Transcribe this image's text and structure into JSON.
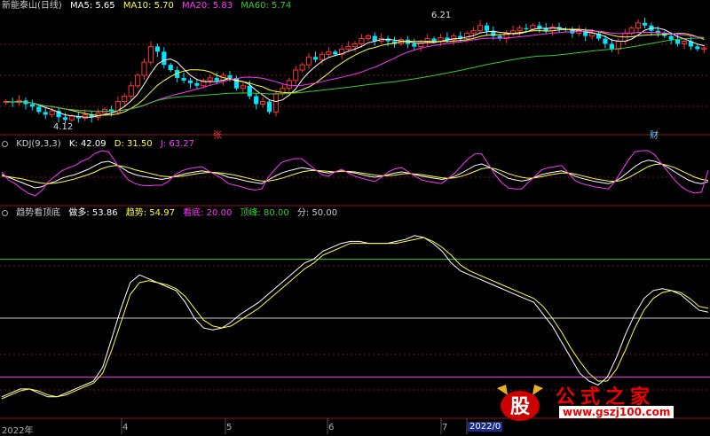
{
  "title": "新能泰山(日线)",
  "ma_labels": [
    {
      "text": "MA5: 5.65",
      "color": "#ffffff"
    },
    {
      "text": "MA10: 5.70",
      "color": "#ffff33"
    },
    {
      "text": "MA20: 5.83",
      "color": "#ff33ff"
    },
    {
      "text": "MA60: 5.74",
      "color": "#33cc33"
    }
  ],
  "kdj_labels": [
    {
      "text": "KDJ(9,3,3)",
      "color": "#cccccc"
    },
    {
      "text": "K: 42.09",
      "color": "#ffffff"
    },
    {
      "text": "D: 31.50",
      "color": "#ffff33"
    },
    {
      "text": "J: 63.27",
      "color": "#ff33ff"
    }
  ],
  "trend_labels": [
    {
      "text": "趋势看顶底",
      "color": "#cccccc"
    },
    {
      "text": "做多: 53.86",
      "color": "#ffffff"
    },
    {
      "text": "趋势: 54.97",
      "color": "#ffff33"
    },
    {
      "text": "看底: 20.00",
      "color": "#ff33ff"
    },
    {
      "text": "顶峰: 80.00",
      "color": "#33cc33"
    },
    {
      "text": "分: 50.00",
      "color": "#cccccc"
    }
  ],
  "annotations": {
    "high": "6.21",
    "low": "4.12",
    "marker_zhang": "张",
    "marker_cai": "财"
  },
  "x_axis": [
    {
      "label": "2022年"
    },
    {
      "label": "4"
    },
    {
      "label": "5"
    },
    {
      "label": "6"
    },
    {
      "label": "7"
    },
    {
      "label": "2022/0"
    }
  ],
  "watermark": {
    "logo_char": "股",
    "title": "公式之家",
    "url": "www.gszj100.com"
  },
  "colors": {
    "up": "#ff3030",
    "down": "#00e5ff",
    "ma5": "#ffffff",
    "ma10": "#ffff33",
    "ma20": "#ff33ff",
    "ma60": "#33cc33",
    "divider": "#8b1a1a",
    "grid": "#7a1a1a"
  },
  "chart_data": [
    {
      "type": "candlestick",
      "title": "新能泰山(日线)",
      "price_range": [
        4.0,
        6.3
      ],
      "close": [
        4.6,
        4.58,
        4.62,
        4.55,
        4.5,
        4.4,
        4.35,
        4.42,
        4.3,
        4.25,
        4.32,
        4.28,
        4.35,
        4.3,
        4.38,
        4.45,
        4.4,
        4.6,
        4.7,
        4.9,
        5.1,
        5.35,
        5.65,
        5.55,
        5.3,
        5.2,
        5.05,
        5.0,
        4.95,
        4.9,
        5.0,
        5.05,
        5.0,
        5.1,
        5.05,
        4.85,
        4.9,
        4.7,
        4.55,
        4.6,
        4.4,
        4.75,
        4.85,
        5.0,
        5.2,
        5.3,
        5.45,
        5.4,
        5.5,
        5.55,
        5.5,
        5.6,
        5.65,
        5.7,
        5.8,
        5.85,
        5.75,
        5.8,
        5.75,
        5.7,
        5.78,
        5.7,
        5.65,
        5.72,
        5.8,
        5.75,
        5.82,
        5.78,
        5.85,
        5.8,
        5.9,
        5.95,
        6.05,
        5.95,
        5.85,
        5.8,
        5.9,
        5.95,
        6.0,
        5.98,
        6.05,
        6.0,
        5.95,
        6.02,
        5.98,
        5.96,
        5.9,
        5.95,
        5.85,
        5.9,
        5.8,
        5.7,
        5.6,
        5.75,
        5.9,
        6.0,
        6.1,
        6.05,
        5.95,
        5.9,
        5.85,
        5.78,
        5.7,
        5.75,
        5.65,
        5.6,
        5.62
      ],
      "ma5_last": 5.65,
      "ma10_last": 5.7,
      "ma20_last": 5.83,
      "ma60_last": 5.74,
      "annotations": [
        {
          "text": "6.21"
        },
        {
          "text": "4.12"
        }
      ]
    },
    {
      "type": "line",
      "title": "KDJ(9,3,3)",
      "ylim": [
        0,
        100
      ],
      "series": [
        {
          "name": "K",
          "values": [
            55,
            50,
            45,
            40,
            35,
            30,
            32,
            38,
            42,
            48,
            52,
            55,
            60,
            65,
            72,
            78,
            80,
            75,
            68,
            60,
            55,
            52,
            50,
            48,
            46,
            48,
            52,
            55,
            58,
            60,
            62,
            60,
            58,
            55,
            50,
            48,
            45,
            42,
            40,
            38,
            45,
            52,
            58,
            62,
            65,
            68,
            66,
            63,
            60,
            58,
            60,
            62,
            60,
            58,
            55,
            52,
            50,
            52,
            55,
            58,
            60,
            58,
            55,
            52,
            50,
            48,
            46,
            48,
            52,
            58,
            65,
            72,
            75,
            70,
            62,
            55,
            48,
            45,
            43,
            45,
            50,
            55,
            58,
            60,
            62,
            58,
            52,
            48,
            45,
            42,
            40,
            38,
            42,
            50,
            60,
            70,
            78,
            82,
            80,
            75,
            68,
            60,
            52,
            45,
            40,
            38,
            42
          ]
        },
        {
          "name": "D",
          "values": [
            52,
            51,
            49,
            47,
            44,
            41,
            39,
            38,
            39,
            41,
            44,
            47,
            51,
            55,
            60,
            66,
            70,
            72,
            71,
            68,
            64,
            61,
            58,
            55,
            52,
            51,
            51,
            52,
            54,
            56,
            58,
            59,
            59,
            58,
            56,
            54,
            51,
            48,
            45,
            43,
            43,
            45,
            48,
            52,
            56,
            60,
            62,
            63,
            62,
            61,
            60,
            61,
            61,
            60,
            58,
            56,
            54,
            53,
            53,
            54,
            56,
            57,
            56,
            55,
            53,
            51,
            49,
            48,
            49,
            52,
            56,
            61,
            66,
            68,
            66,
            62,
            57,
            53,
            50,
            48,
            49,
            51,
            54,
            56,
            58,
            58,
            56,
            53,
            50,
            47,
            45,
            43,
            42,
            44,
            49,
            56,
            63,
            70,
            74,
            75,
            72,
            68,
            62,
            56,
            50,
            46,
            44
          ]
        },
        {
          "name": "J",
          "values": [
            60,
            45,
            38,
            28,
            20,
            15,
            25,
            42,
            52,
            62,
            68,
            72,
            80,
            85,
            95,
            100,
            98,
            80,
            60,
            45,
            38,
            35,
            34,
            35,
            35,
            42,
            55,
            62,
            66,
            68,
            70,
            62,
            55,
            48,
            38,
            35,
            32,
            28,
            26,
            28,
            50,
            65,
            78,
            82,
            85,
            85,
            75,
            65,
            55,
            52,
            60,
            65,
            58,
            52,
            48,
            45,
            42,
            50,
            60,
            66,
            68,
            60,
            52,
            45,
            42,
            40,
            38,
            48,
            58,
            72,
            85,
            94,
            94,
            75,
            55,
            40,
            30,
            28,
            28,
            40,
            52,
            64,
            68,
            70,
            72,
            58,
            44,
            38,
            35,
            32,
            30,
            28,
            42,
            62,
            82,
            98,
            100,
            100,
            92,
            75,
            60,
            44,
            32,
            24,
            20,
            22,
            63
          ]
        }
      ]
    },
    {
      "type": "line",
      "title": "趋势看顶底",
      "ylim": [
        0,
        100
      ],
      "reference_lines": {
        "顶峰": 80.0,
        "分": 50.0,
        "看底": 20.0
      },
      "series": [
        {
          "name": "做多",
          "values": [
            10,
            12,
            14,
            14,
            12,
            10,
            10,
            12,
            14,
            16,
            18,
            25,
            40,
            55,
            68,
            72,
            70,
            68,
            66,
            64,
            58,
            50,
            45,
            44,
            45,
            48,
            52,
            55,
            58,
            62,
            66,
            70,
            74,
            78,
            80,
            84,
            86,
            88,
            89,
            89,
            88,
            88,
            88,
            89,
            90,
            92,
            91,
            88,
            84,
            78,
            74,
            72,
            70,
            68,
            66,
            64,
            62,
            60,
            58,
            52,
            46,
            38,
            30,
            22,
            18,
            16,
            20,
            30,
            42,
            52,
            60,
            64,
            65,
            64,
            62,
            58,
            54,
            53
          ]
        },
        {
          "name": "趋势",
          "values": [
            9,
            11,
            13,
            14,
            13,
            11,
            10,
            11,
            13,
            15,
            17,
            22,
            34,
            48,
            62,
            68,
            69,
            68,
            67,
            65,
            61,
            55,
            49,
            46,
            45,
            46,
            49,
            52,
            55,
            59,
            63,
            67,
            71,
            75,
            78,
            82,
            84,
            86,
            88,
            88,
            88,
            88,
            88,
            88,
            89,
            90,
            91,
            89,
            86,
            82,
            77,
            74,
            72,
            70,
            68,
            66,
            64,
            62,
            60,
            56,
            50,
            43,
            35,
            28,
            22,
            18,
            18,
            24,
            34,
            45,
            54,
            60,
            63,
            64,
            63,
            60,
            56,
            55
          ]
        }
      ]
    }
  ]
}
